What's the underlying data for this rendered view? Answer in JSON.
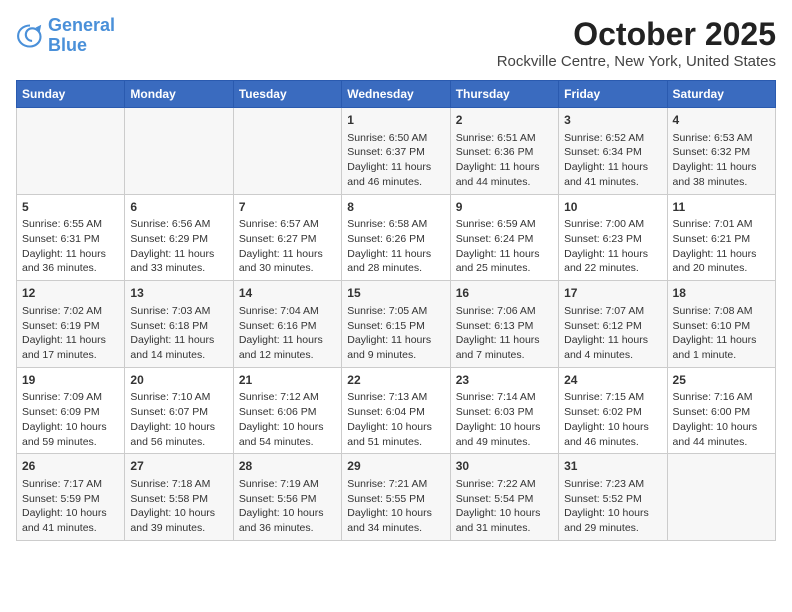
{
  "header": {
    "logo_line1": "General",
    "logo_line2": "Blue",
    "month": "October 2025",
    "location": "Rockville Centre, New York, United States"
  },
  "days_of_week": [
    "Sunday",
    "Monday",
    "Tuesday",
    "Wednesday",
    "Thursday",
    "Friday",
    "Saturday"
  ],
  "weeks": [
    [
      {
        "day": "",
        "content": ""
      },
      {
        "day": "",
        "content": ""
      },
      {
        "day": "",
        "content": ""
      },
      {
        "day": "1",
        "content": "Sunrise: 6:50 AM\nSunset: 6:37 PM\nDaylight: 11 hours and 46 minutes."
      },
      {
        "day": "2",
        "content": "Sunrise: 6:51 AM\nSunset: 6:36 PM\nDaylight: 11 hours and 44 minutes."
      },
      {
        "day": "3",
        "content": "Sunrise: 6:52 AM\nSunset: 6:34 PM\nDaylight: 11 hours and 41 minutes."
      },
      {
        "day": "4",
        "content": "Sunrise: 6:53 AM\nSunset: 6:32 PM\nDaylight: 11 hours and 38 minutes."
      }
    ],
    [
      {
        "day": "5",
        "content": "Sunrise: 6:55 AM\nSunset: 6:31 PM\nDaylight: 11 hours and 36 minutes."
      },
      {
        "day": "6",
        "content": "Sunrise: 6:56 AM\nSunset: 6:29 PM\nDaylight: 11 hours and 33 minutes."
      },
      {
        "day": "7",
        "content": "Sunrise: 6:57 AM\nSunset: 6:27 PM\nDaylight: 11 hours and 30 minutes."
      },
      {
        "day": "8",
        "content": "Sunrise: 6:58 AM\nSunset: 6:26 PM\nDaylight: 11 hours and 28 minutes."
      },
      {
        "day": "9",
        "content": "Sunrise: 6:59 AM\nSunset: 6:24 PM\nDaylight: 11 hours and 25 minutes."
      },
      {
        "day": "10",
        "content": "Sunrise: 7:00 AM\nSunset: 6:23 PM\nDaylight: 11 hours and 22 minutes."
      },
      {
        "day": "11",
        "content": "Sunrise: 7:01 AM\nSunset: 6:21 PM\nDaylight: 11 hours and 20 minutes."
      }
    ],
    [
      {
        "day": "12",
        "content": "Sunrise: 7:02 AM\nSunset: 6:19 PM\nDaylight: 11 hours and 17 minutes."
      },
      {
        "day": "13",
        "content": "Sunrise: 7:03 AM\nSunset: 6:18 PM\nDaylight: 11 hours and 14 minutes."
      },
      {
        "day": "14",
        "content": "Sunrise: 7:04 AM\nSunset: 6:16 PM\nDaylight: 11 hours and 12 minutes."
      },
      {
        "day": "15",
        "content": "Sunrise: 7:05 AM\nSunset: 6:15 PM\nDaylight: 11 hours and 9 minutes."
      },
      {
        "day": "16",
        "content": "Sunrise: 7:06 AM\nSunset: 6:13 PM\nDaylight: 11 hours and 7 minutes."
      },
      {
        "day": "17",
        "content": "Sunrise: 7:07 AM\nSunset: 6:12 PM\nDaylight: 11 hours and 4 minutes."
      },
      {
        "day": "18",
        "content": "Sunrise: 7:08 AM\nSunset: 6:10 PM\nDaylight: 11 hours and 1 minute."
      }
    ],
    [
      {
        "day": "19",
        "content": "Sunrise: 7:09 AM\nSunset: 6:09 PM\nDaylight: 10 hours and 59 minutes."
      },
      {
        "day": "20",
        "content": "Sunrise: 7:10 AM\nSunset: 6:07 PM\nDaylight: 10 hours and 56 minutes."
      },
      {
        "day": "21",
        "content": "Sunrise: 7:12 AM\nSunset: 6:06 PM\nDaylight: 10 hours and 54 minutes."
      },
      {
        "day": "22",
        "content": "Sunrise: 7:13 AM\nSunset: 6:04 PM\nDaylight: 10 hours and 51 minutes."
      },
      {
        "day": "23",
        "content": "Sunrise: 7:14 AM\nSunset: 6:03 PM\nDaylight: 10 hours and 49 minutes."
      },
      {
        "day": "24",
        "content": "Sunrise: 7:15 AM\nSunset: 6:02 PM\nDaylight: 10 hours and 46 minutes."
      },
      {
        "day": "25",
        "content": "Sunrise: 7:16 AM\nSunset: 6:00 PM\nDaylight: 10 hours and 44 minutes."
      }
    ],
    [
      {
        "day": "26",
        "content": "Sunrise: 7:17 AM\nSunset: 5:59 PM\nDaylight: 10 hours and 41 minutes."
      },
      {
        "day": "27",
        "content": "Sunrise: 7:18 AM\nSunset: 5:58 PM\nDaylight: 10 hours and 39 minutes."
      },
      {
        "day": "28",
        "content": "Sunrise: 7:19 AM\nSunset: 5:56 PM\nDaylight: 10 hours and 36 minutes."
      },
      {
        "day": "29",
        "content": "Sunrise: 7:21 AM\nSunset: 5:55 PM\nDaylight: 10 hours and 34 minutes."
      },
      {
        "day": "30",
        "content": "Sunrise: 7:22 AM\nSunset: 5:54 PM\nDaylight: 10 hours and 31 minutes."
      },
      {
        "day": "31",
        "content": "Sunrise: 7:23 AM\nSunset: 5:52 PM\nDaylight: 10 hours and 29 minutes."
      },
      {
        "day": "",
        "content": ""
      }
    ]
  ]
}
